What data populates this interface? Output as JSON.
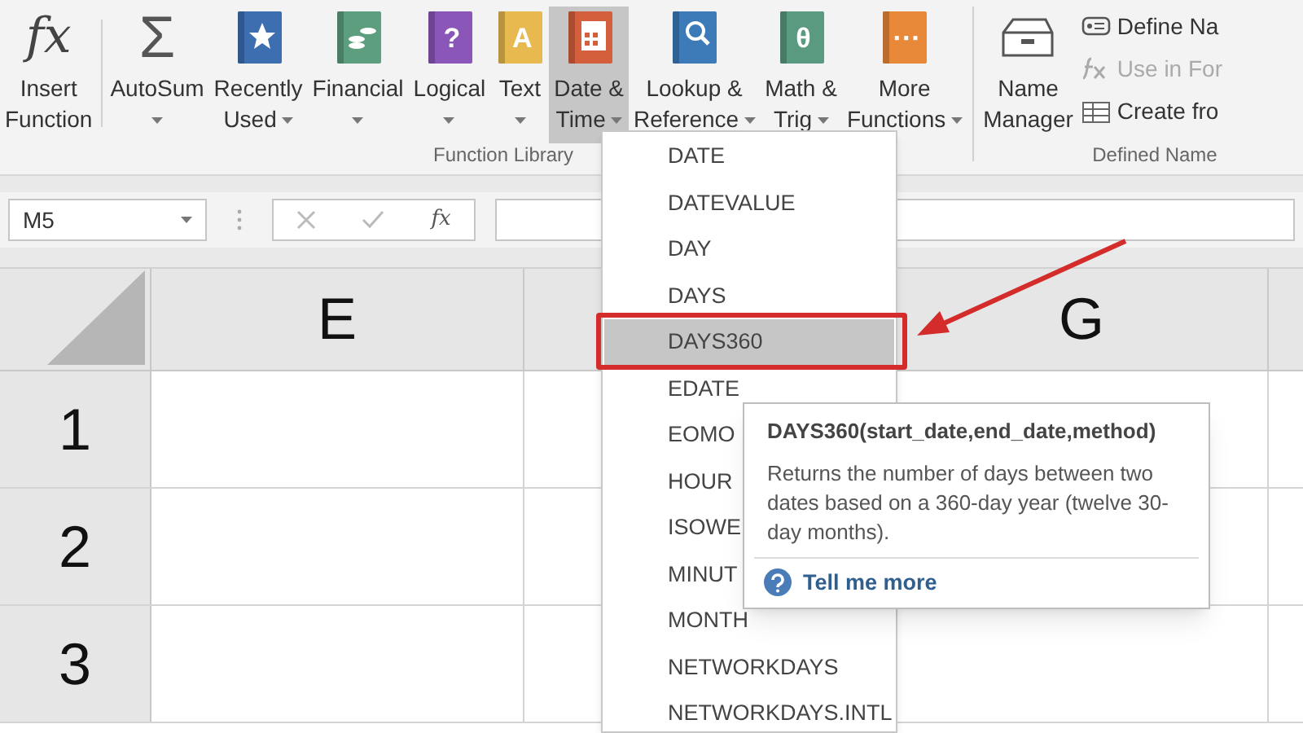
{
  "ribbon": {
    "buttons": [
      {
        "kind": "glyph",
        "glyph": "fx",
        "lines": [
          "Insert",
          "Function"
        ],
        "dropdown": false,
        "selected": false
      },
      {
        "kind": "glyph",
        "glyph": "Σ",
        "lines": [
          "AutoSum"
        ],
        "dropdown": true,
        "selected": false
      },
      {
        "kind": "star",
        "color": "#3d6fb0",
        "lines": [
          "Recently",
          "Used"
        ],
        "dropdown": true,
        "selected": false
      },
      {
        "kind": "coins",
        "color": "#5c9e7e",
        "lines": [
          "Financial"
        ],
        "dropdown": true,
        "selected": false
      },
      {
        "kind": "book",
        "color": "#8a56b8",
        "glyph": "?",
        "lines": [
          "Logical"
        ],
        "dropdown": true,
        "selected": false
      },
      {
        "kind": "book",
        "color": "#e8b94f",
        "glyph": "A",
        "lines": [
          "Text"
        ],
        "dropdown": true,
        "selected": false
      },
      {
        "kind": "calendar",
        "color": "#d45f3c",
        "lines": [
          "Date &",
          "Time"
        ],
        "dropdown": true,
        "selected": true
      },
      {
        "kind": "search",
        "color": "#3d7ab8",
        "lines": [
          "Lookup &",
          "Reference"
        ],
        "dropdown": true,
        "selected": false
      },
      {
        "kind": "book",
        "color": "#5a9a80",
        "glyph": "θ",
        "lines": [
          "Math &",
          "Trig"
        ],
        "dropdown": true,
        "selected": false
      },
      {
        "kind": "book",
        "color": "#e8893a",
        "glyph": "···",
        "lines": [
          "More",
          "Functions"
        ],
        "dropdown": true,
        "selected": false
      }
    ],
    "group_label": "Function Library",
    "name_manager": {
      "lines": [
        "Name",
        "Manager"
      ]
    },
    "name_commands": [
      {
        "kind": "define",
        "label": "Define Na",
        "disabled": false
      },
      {
        "kind": "use",
        "label": "Use in For",
        "disabled": true
      },
      {
        "kind": "create",
        "label": "Create fro",
        "disabled": false
      }
    ],
    "names_group_label": "Defined Name"
  },
  "formula_bar": {
    "name_box": "M5",
    "function_glyph": "fx"
  },
  "sheet": {
    "columns": [
      "E",
      "G"
    ],
    "rows": [
      "1",
      "2",
      "3"
    ]
  },
  "dropdown": {
    "items": [
      {
        "label": "DATE",
        "selected": false
      },
      {
        "label": "DATEVALUE",
        "selected": false
      },
      {
        "label": "DAY",
        "selected": false
      },
      {
        "label": "DAYS",
        "selected": false
      },
      {
        "label": "DAYS360",
        "selected": true
      },
      {
        "label": "EDATE",
        "selected": false
      },
      {
        "label": "EOMO",
        "selected": false
      },
      {
        "label": "HOUR",
        "selected": false
      },
      {
        "label": "ISOWE",
        "selected": false
      },
      {
        "label": "MINUT",
        "selected": false
      },
      {
        "label": "MONTH",
        "selected": false
      },
      {
        "label": "NETWORKDAYS",
        "selected": false
      },
      {
        "label": "NETWORKDAYS.INTL",
        "selected": false
      }
    ]
  },
  "tooltip": {
    "title": "DAYS360(start_date,end_date,method)",
    "description": "Returns the number of days between two dates based on a 360-day year (twelve 30-day months).",
    "link": "Tell me more"
  }
}
